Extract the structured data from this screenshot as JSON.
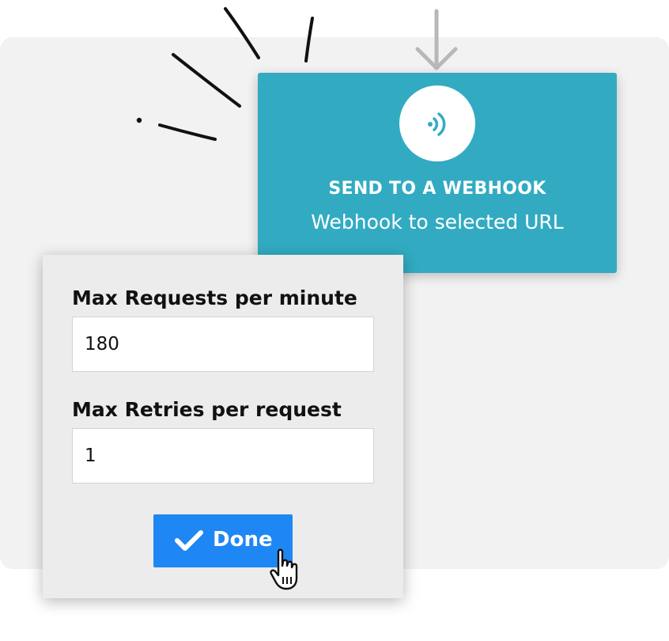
{
  "webhook_card": {
    "icon": "webhook-signal-icon",
    "title": "SEND TO A WEBHOOK",
    "subtitle": "Webhook to selected URL",
    "background_color": "#32abc2"
  },
  "settings": {
    "max_requests_label": "Max Requests per minute",
    "max_requests_value": "180",
    "max_retries_label": "Max Retries per request",
    "max_retries_value": "1"
  },
  "done_button": {
    "icon": "checkmark-icon",
    "label": "Done",
    "color": "#1f87f3"
  },
  "cursor": {
    "icon": "pointer-hand-icon"
  },
  "connector": {
    "icon": "arrow-down-icon"
  }
}
